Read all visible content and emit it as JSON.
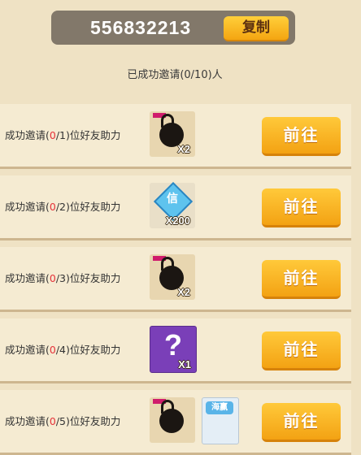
{
  "invite_code": "556832213",
  "copy_label": "复制",
  "summary": "已成功邀请(0/10)人",
  "rows": [
    {
      "prefix": "成功邀请(",
      "num": "0",
      "suffix": "/1)位好友助力",
      "qty": "X2",
      "button": "前往"
    },
    {
      "prefix": "成功邀请(",
      "num": "0",
      "suffix": "/2)位好友助力",
      "qty": "X200",
      "button": "前往",
      "gem_char": "信"
    },
    {
      "prefix": "成功邀请(",
      "num": "0",
      "suffix": "/3)位好友助力",
      "qty": "X2",
      "button": "前往"
    },
    {
      "prefix": "成功邀请(",
      "num": "0",
      "suffix": "/4)位好友助力",
      "qty": "X1",
      "button": "前往",
      "mystery_mark": "?"
    },
    {
      "prefix": "成功邀请(",
      "num": "0",
      "suffix": "/5)位好友助力",
      "button": "前往",
      "hero_tag": "海赢"
    }
  ],
  "icons": {
    "bomb": "bomb-icon",
    "gem": "gem-icon",
    "mystery": "mystery-box-icon",
    "hero": "hero-card-icon"
  }
}
